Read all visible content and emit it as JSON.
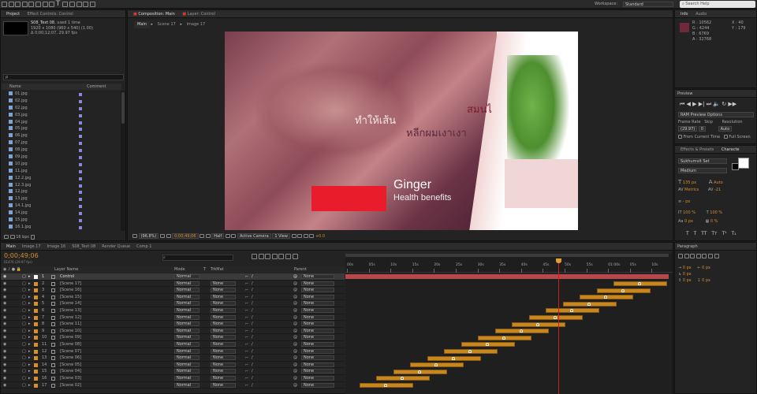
{
  "toolbar": {
    "workspace_label": "Workspace:",
    "workspace_value": "Standard",
    "search_placeholder": "Search Help"
  },
  "project": {
    "tab_project": "Project",
    "tab_effect_controls": "Effect Controls: Control",
    "item_name": "S08_Text 08",
    "item_used": ", used 1 time",
    "item_size": "1920 x 1080  (960 x 540) (1.00)",
    "item_duration": "Δ 0;00;12;07, 29.97 fps",
    "search_placeholder": "ρ",
    "col_name": "Name",
    "col_comment": "Comment",
    "files": [
      "01.jpg",
      "02.jpg",
      "02.jpg",
      "03.jpg",
      "04.jpg",
      "05.jpg",
      "06.jpg",
      "07.jpg",
      "08.jpg",
      "09.jpg",
      "10.jpg",
      "11.jpg",
      "12.2.jpg",
      "12.3.jpg",
      "12.jpg",
      "13.jpg",
      "14.1.jpg",
      "14.jpg",
      "15.jpg",
      "16.1.jpg"
    ],
    "bpc": "16 bpc"
  },
  "composition": {
    "tab_label": "Composition: Main",
    "layer_tab": "Layer: Control",
    "breadcrumbs": [
      "Main",
      "Scene 17",
      "Image 17"
    ],
    "text_line1": "ทำให้เส้น",
    "text_line2": "หลีกผมเงาเงา",
    "text_right": "สมนไ",
    "title": "Ginger",
    "subtitle": "Health benefits",
    "zoom": "(96.8%)",
    "timecode": "0;00;49;06",
    "resolution": "Half",
    "camera": "Active Camera",
    "view": "1 View",
    "exposure": "+0.0"
  },
  "info": {
    "tab_info": "Info",
    "tab_audio": "Audio",
    "r": "R : 10562",
    "g": "G : 4244",
    "b": "B : 6769",
    "a": "A : 32768",
    "x": "X : 40",
    "y": "Y : 179"
  },
  "preview": {
    "title": "Preview",
    "ram_options": "RAM Preview Options",
    "frame_rate_label": "Frame Rate",
    "skip_label": "Skip",
    "resolution_label": "Resolution",
    "frame_rate": "(29.97)",
    "skip": "0",
    "resolution": "Auto",
    "from_current": "From Current Time",
    "full_screen": "Full Screen"
  },
  "character": {
    "tab_effects": "Effects & Presets",
    "tab_character": "Characte",
    "font": "Sukhumvit Set",
    "style": "Medium",
    "size": "135 px",
    "leading": "Auto",
    "kerning": "Metrics",
    "tracking": "-21",
    "stroke": "- px",
    "vscale": "100 %",
    "hscale": "100 %",
    "baseline": "0 px",
    "tsume": "0 %"
  },
  "paragraph": {
    "title": "Paragraph",
    "indent1": "0 px",
    "indent2": "0 px",
    "indent3": "0 px",
    "space1": "0 px",
    "space2": "0 px"
  },
  "timeline": {
    "tabs": [
      "Main",
      "Image 17",
      "Image 16",
      "S08_Text 08",
      "Render Queue",
      "Comp 1"
    ],
    "timecode": "0;00;49;06",
    "fps": "01476 (29.97 fps)",
    "col_layer": "Layer Name",
    "col_mode": "Mode",
    "col_t": "T",
    "col_trkmat": "TrkMat",
    "col_parent": "Parent",
    "ruler": [
      "00s",
      "05s",
      "10s",
      "15s",
      "20s",
      "25s",
      "30s",
      "35s",
      "40s",
      "45s",
      "50s",
      "55s",
      "01:00s",
      "05s",
      "10s"
    ],
    "layers": [
      {
        "num": "1",
        "name": "Control",
        "mode": "Normal",
        "trkmat": "",
        "parent": "None"
      },
      {
        "num": "2",
        "name": "[Scene 17]",
        "mode": "Normal",
        "trkmat": "None",
        "parent": "None"
      },
      {
        "num": "3",
        "name": "[Scene 16]",
        "mode": "Normal",
        "trkmat": "None",
        "parent": "None"
      },
      {
        "num": "4",
        "name": "[Scene 15]",
        "mode": "Normal",
        "trkmat": "None",
        "parent": "None"
      },
      {
        "num": "5",
        "name": "[Scene 14]",
        "mode": "Normal",
        "trkmat": "None",
        "parent": "None"
      },
      {
        "num": "6",
        "name": "[Scene 13]",
        "mode": "Normal",
        "trkmat": "None",
        "parent": "None"
      },
      {
        "num": "7",
        "name": "[Scene 12]",
        "mode": "Normal",
        "trkmat": "None",
        "parent": "None"
      },
      {
        "num": "8",
        "name": "[Scene 11]",
        "mode": "Normal",
        "trkmat": "None",
        "parent": "None"
      },
      {
        "num": "9",
        "name": "[Scene 10]",
        "mode": "Normal",
        "trkmat": "None",
        "parent": "None"
      },
      {
        "num": "10",
        "name": "[Scene 09]",
        "mode": "Normal",
        "trkmat": "None",
        "parent": "None"
      },
      {
        "num": "11",
        "name": "[Scene 08]",
        "mode": "Normal",
        "trkmat": "None",
        "parent": "None"
      },
      {
        "num": "12",
        "name": "[Scene 07]",
        "mode": "Normal",
        "trkmat": "None",
        "parent": "None"
      },
      {
        "num": "13",
        "name": "[Scene 06]",
        "mode": "Normal",
        "trkmat": "None",
        "parent": "None"
      },
      {
        "num": "14",
        "name": "[Scene 05]",
        "mode": "Normal",
        "trkmat": "None",
        "parent": "None"
      },
      {
        "num": "15",
        "name": "[Scene 04]",
        "mode": "Normal",
        "trkmat": "None",
        "parent": "None"
      },
      {
        "num": "16",
        "name": "[Scene 03]",
        "mode": "Normal",
        "trkmat": "None",
        "parent": "None"
      },
      {
        "num": "17",
        "name": "[Scene 02]",
        "mode": "Normal",
        "trkmat": "None",
        "parent": "None"
      }
    ]
  },
  "colors": {
    "accent_orange": "#d68f2a",
    "layer_bar": "#c7861e",
    "control_bar": "#b5484c",
    "playhead": "#c81e1e"
  }
}
